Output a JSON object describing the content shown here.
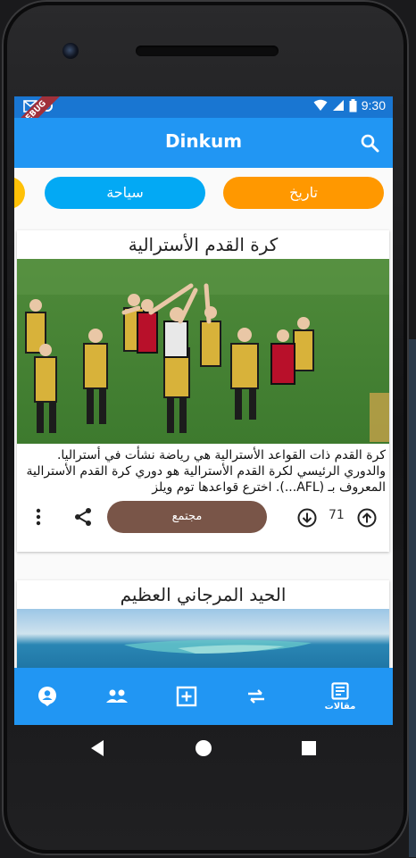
{
  "status_bar": {
    "time": "9:30",
    "debug_label": "DEBUG"
  },
  "app_bar": {
    "title": "Dinkum",
    "search_icon": "search-icon"
  },
  "chips": [
    {
      "label": "تاريخ",
      "color": "#ff9800"
    },
    {
      "label": "سياحة",
      "color": "#03a9f4"
    },
    {
      "label": "",
      "color": "#ffc107"
    }
  ],
  "articles": [
    {
      "title": "كرة القدم الأسترالية",
      "description": "كرة القدم ذات القواعد الأسترالية هي رياضة نشأت في أستراليا. والدوري الرئيسي لكرة القدم الأسترالية هو دوري كرة القدم الأسترالية المعروف بـ (AFL...). اخترع قواعدها توم ويلز",
      "category_button": "مجتمع",
      "votes": "71"
    },
    {
      "title": "الحيد المرجاني العظيم"
    }
  ],
  "bottom_nav": {
    "articles_label": "مقالات"
  }
}
